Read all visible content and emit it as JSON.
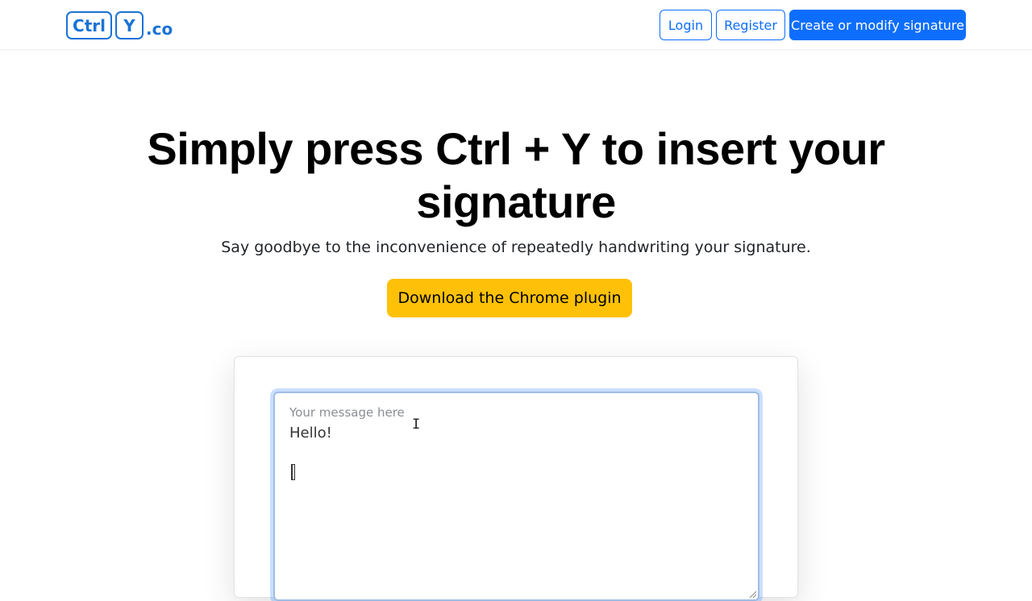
{
  "brand": {
    "key1": "Ctrl",
    "key2": "Y",
    "tld": ".co",
    "color": "#1a73d6"
  },
  "nav": {
    "login": "Login",
    "register": "Register",
    "create": "Create or modify signature"
  },
  "hero": {
    "title": "Simply press Ctrl + Y to insert your signature",
    "subtitle": "Say goodbye to the inconvenience of repeatedly handwriting your signature.",
    "cta": "Download the Chrome plugin"
  },
  "demo": {
    "placeholder": "Your message here",
    "message": "Hello!"
  },
  "colors": {
    "primary": "#0d6efd",
    "cta": "#ffc107"
  }
}
